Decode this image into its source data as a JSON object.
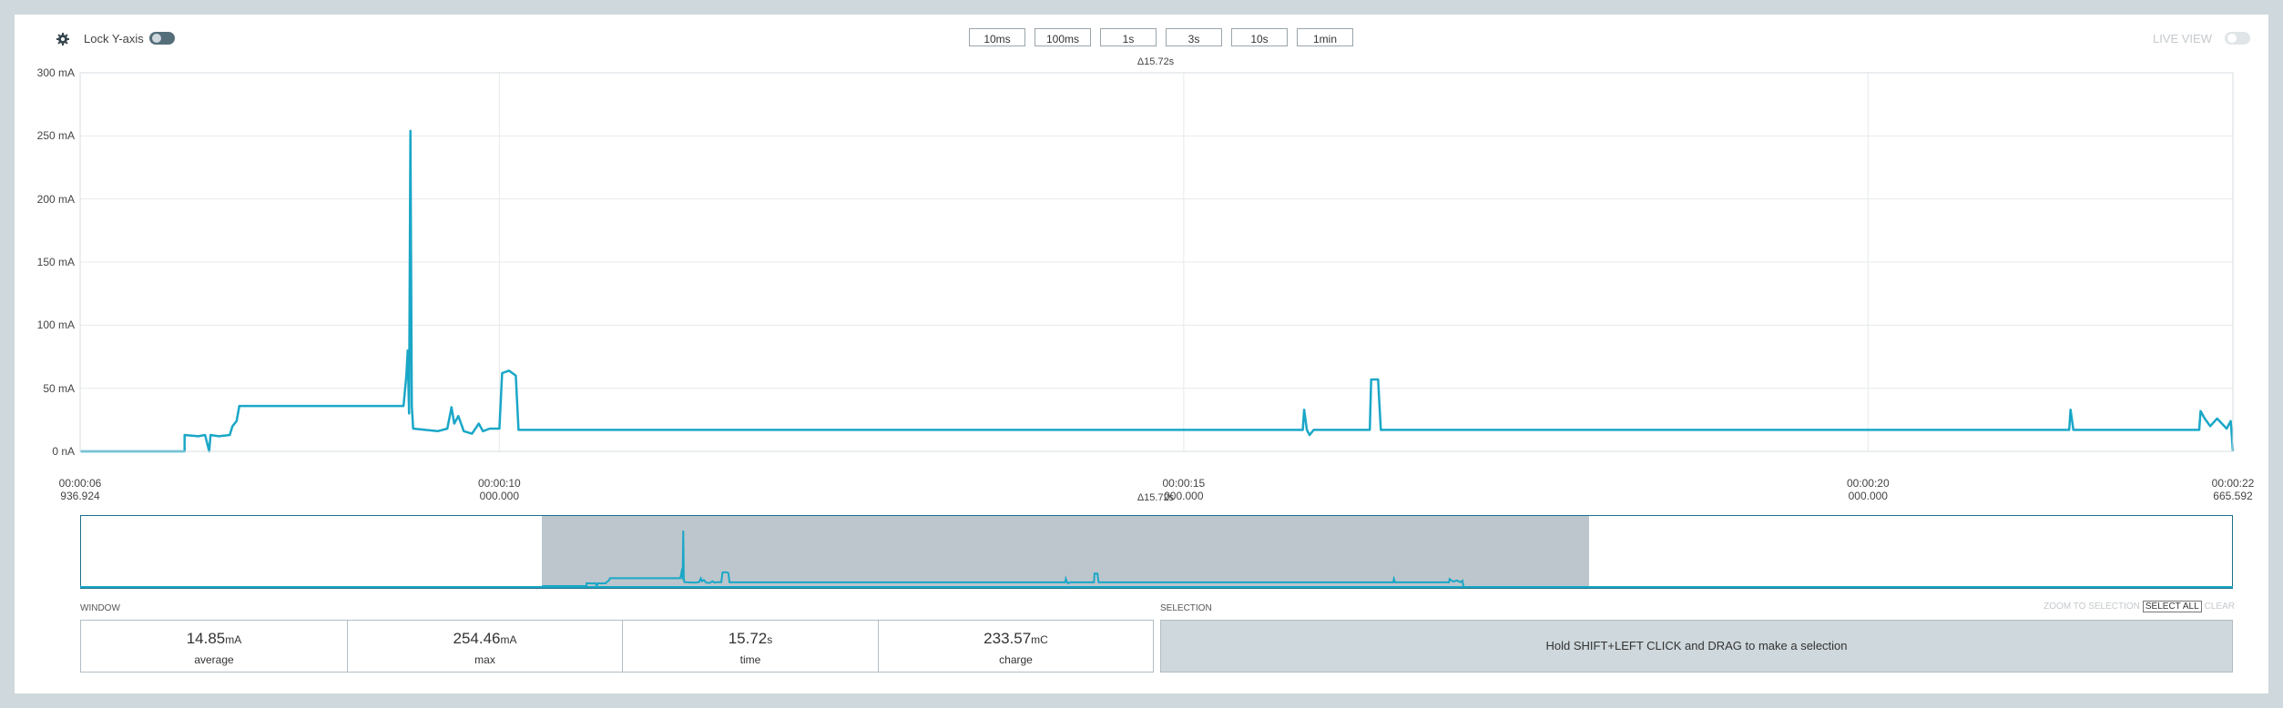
{
  "toolbar": {
    "settings_icon": "gear-icon",
    "lock_y_label": "Lock Y-axis",
    "window_buttons": [
      "10ms",
      "100ms",
      "1s",
      "3s",
      "10s",
      "1min"
    ],
    "live_view_label": "LIVE VIEW"
  },
  "chart_data": {
    "type": "line",
    "delta_label": "Δ15.72s",
    "y_ticks": [
      "300 mA",
      "250 mA",
      "200 mA",
      "150 mA",
      "100 mA",
      "50 mA",
      "0 nA"
    ],
    "ylim": [
      0,
      300
    ],
    "x_ticks": [
      {
        "top": "00:00:06",
        "bottom": "936.924"
      },
      {
        "top": "00:00:10",
        "bottom": "000.000"
      },
      {
        "top": "00:00:15",
        "bottom": "000.000"
      },
      {
        "top": "00:00:20",
        "bottom": "000.000"
      },
      {
        "top": "00:00:22",
        "bottom": "665.592"
      }
    ],
    "xlim_seconds": [
      6.937,
      22.666
    ],
    "series": [
      {
        "color": "#1aa7c7",
        "points": [
          [
            6.94,
            0
          ],
          [
            7.7,
            0
          ],
          [
            7.7,
            13
          ],
          [
            7.8,
            12
          ],
          [
            7.85,
            13
          ],
          [
            7.88,
            0
          ],
          [
            7.89,
            13
          ],
          [
            7.95,
            12
          ],
          [
            8.03,
            13
          ],
          [
            8.05,
            20
          ],
          [
            8.08,
            24
          ],
          [
            8.1,
            36
          ],
          [
            8.5,
            36
          ],
          [
            8.8,
            36
          ],
          [
            9.3,
            36
          ],
          [
            9.32,
            60
          ],
          [
            9.33,
            80
          ],
          [
            9.34,
            30
          ],
          [
            9.35,
            254
          ],
          [
            9.36,
            36
          ],
          [
            9.37,
            18
          ],
          [
            9.55,
            16
          ],
          [
            9.62,
            18
          ],
          [
            9.65,
            35
          ],
          [
            9.67,
            22
          ],
          [
            9.7,
            28
          ],
          [
            9.72,
            22
          ],
          [
            9.74,
            16
          ],
          [
            9.8,
            14
          ],
          [
            9.85,
            22
          ],
          [
            9.88,
            16
          ],
          [
            9.93,
            18
          ],
          [
            10.0,
            18
          ],
          [
            10.02,
            62
          ],
          [
            10.07,
            64
          ],
          [
            10.12,
            60
          ],
          [
            10.14,
            17
          ],
          [
            11.5,
            17
          ],
          [
            14.0,
            17
          ],
          [
            15.87,
            17
          ],
          [
            15.88,
            33
          ],
          [
            15.9,
            17
          ],
          [
            15.92,
            13
          ],
          [
            15.95,
            17
          ],
          [
            16.36,
            17
          ],
          [
            16.37,
            57
          ],
          [
            16.42,
            57
          ],
          [
            16.44,
            17
          ],
          [
            18.0,
            17
          ],
          [
            21.47,
            17
          ],
          [
            21.48,
            33
          ],
          [
            21.5,
            17
          ],
          [
            22.42,
            17
          ],
          [
            22.43,
            32
          ],
          [
            22.46,
            26
          ],
          [
            22.5,
            20
          ],
          [
            22.55,
            26
          ],
          [
            22.62,
            18
          ],
          [
            22.65,
            24
          ],
          [
            22.666,
            0
          ]
        ]
      }
    ]
  },
  "overview": {
    "delta_label": "Δ15.72s"
  },
  "window_stats": {
    "section_label": "WINDOW",
    "average": {
      "value": "14.85",
      "unit": "mA",
      "label": "average"
    },
    "max": {
      "value": "254.46",
      "unit": "mA",
      "label": "max"
    },
    "time": {
      "value": "15.72",
      "unit": "s",
      "label": "time"
    },
    "charge": {
      "value": "233.57",
      "unit": "mC",
      "label": "charge"
    }
  },
  "selection": {
    "section_label": "SELECTION",
    "zoom_label": "ZOOM TO SELECTION",
    "select_all_label": "SELECT ALL",
    "clear_label": "CLEAR",
    "hint": "Hold SHIFT+LEFT CLICK and DRAG to make a selection"
  }
}
